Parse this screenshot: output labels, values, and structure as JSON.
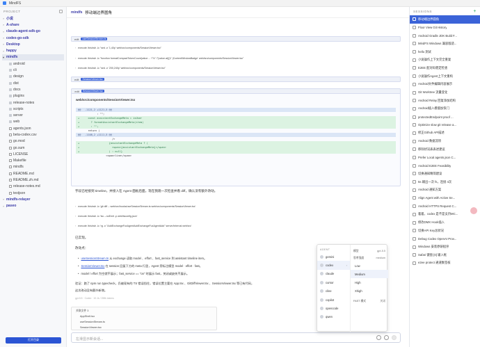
{
  "window": {
    "title": "MindFS"
  },
  "left_sidebar": {
    "header": "PROJECT",
    "tree": [
      {
        "label": "小说",
        "level": 0,
        "type": "folder",
        "expanded": false
      },
      {
        "label": "A-share",
        "level": 0,
        "type": "folder",
        "expanded": false
      },
      {
        "label": "claude-agent-sdk-go",
        "level": 0,
        "type": "folder",
        "expanded": false
      },
      {
        "label": "codex-go-sdk",
        "level": 0,
        "type": "folder",
        "expanded": false
      },
      {
        "label": "Desktop",
        "level": 0,
        "type": "folder",
        "expanded": false
      },
      {
        "label": "happy",
        "level": 0,
        "type": "folder",
        "expanded": false
      },
      {
        "label": "mindfs",
        "level": 0,
        "type": "folder",
        "expanded": true,
        "active": true
      },
      {
        "label": "android",
        "level": 1,
        "type": "folder"
      },
      {
        "label": "cli",
        "level": 1,
        "type": "folder"
      },
      {
        "label": "design",
        "level": 1,
        "type": "folder"
      },
      {
        "label": "dist",
        "level": 1,
        "type": "folder"
      },
      {
        "label": "docs",
        "level": 1,
        "type": "folder"
      },
      {
        "label": "plugins",
        "level": 1,
        "type": "folder"
      },
      {
        "label": "release-notes",
        "level": 1,
        "type": "folder"
      },
      {
        "label": "scripts",
        "level": 1,
        "type": "folder"
      },
      {
        "label": "server",
        "level": 1,
        "type": "folder"
      },
      {
        "label": "web",
        "level": 1,
        "type": "folder"
      },
      {
        "label": "agents.json",
        "level": 1,
        "type": "file"
      },
      {
        "label": "beta-codex.csv",
        "level": 1,
        "type": "file"
      },
      {
        "label": "go.mod",
        "level": 1,
        "type": "file"
      },
      {
        "label": "go.sum",
        "level": 1,
        "type": "file"
      },
      {
        "label": "LICENSE",
        "level": 1,
        "type": "file"
      },
      {
        "label": "Makefile",
        "level": 1,
        "type": "file"
      },
      {
        "label": "mindfs",
        "level": 1,
        "type": "file"
      },
      {
        "label": "README.md",
        "level": 1,
        "type": "file"
      },
      {
        "label": "README.zh.md",
        "level": 1,
        "type": "file"
      },
      {
        "label": "release-notes.md",
        "level": 1,
        "type": "file"
      },
      {
        "label": "testjson",
        "level": 1,
        "type": "file"
      },
      {
        "label": "mindfs-relayer",
        "level": 0,
        "type": "folder",
        "expanded": false
      },
      {
        "label": "paseo",
        "level": 0,
        "type": "folder",
        "expanded": false
      }
    ],
    "open_button": "打开目录"
  },
  "main": {
    "project_tag": "mindfs",
    "session_title": "移动端边界圆角",
    "tool_rows": [
      {
        "name": "edit",
        "file": "useSessionStream.ts"
      },
      {
        "name": "edit",
        "file": "SessionViewer.tsx"
      },
      {
        "name": "edit",
        "file": "SessionViewer.tsx"
      }
    ],
    "commands": [
      "execute /bin/zsh -lc \"sed -n '1,40p' web/src/components/SessionViewer.tsx\"",
      "execute /bin/zsh -lc \"function formatCompactTokenCount(value ... \\\"\\\\\\\" \\\"(value.at())\\\" |ContextWindowBadge' web/src/components/SessionViewer.tsx\"",
      "execute /bin/zsh -lc \"sed -n '200,240p' web/src/components/SessionViewer.tsx\"",
      "execute /bin/zsh -lc 'git diff -- web/src/hooks/useSessionStream.ts web/src/components/SessionViewer.tsx'",
      "execute /bin/zsh -lc 'tsc --noEmit -p web/tsconfig.json'",
      "execute /bin/zsh -lc 'rg -n \"AddExchangeFuxAgentAddExchangeFuxAgentAdd\" server/internal web/src'"
    ],
    "diff": {
      "path": "web/src/components/SessionViewer.tsx",
      "lines": [
        {
          "type": "hunk",
          "sign": "@@",
          "text": "-1121,2 +1121,5 @@"
        },
        {
          "type": "ctx",
          "sign": "",
          "text": "        : \"\";"
        },
        {
          "type": "add",
          "sign": "+",
          "text": "  const assistantExchangeMeta = isUser"
        },
        {
          "type": "add",
          "sign": "+",
          "text": "    ? formatAssistantExchangeMeta(item)"
        },
        {
          "type": "add",
          "sign": "+",
          "text": "    : \"\";"
        },
        {
          "type": "ctx",
          "sign": "",
          "text": "  return ("
        },
        {
          "type": "hunk",
          "sign": "@@",
          "text": "-1108,2 +1111,5 @@"
        },
        {
          "type": "ctx",
          "sign": "",
          "text": "                  />"
        },
        {
          "type": "add",
          "sign": "+",
          "text": "                {assistantExchangeMeta ? ("
        },
        {
          "type": "add",
          "sign": "+",
          "text": "                  <span>{assistantExchangeMeta}</span>"
        },
        {
          "type": "add",
          "sign": "+",
          "text": "                ) : null}"
        },
        {
          "type": "ctx",
          "sign": "",
          "text": "              <span>line</span>"
        }
      ]
    },
    "para1": "字段已经接到 timeline，并接入在 Agent 面板后面。现在我跑一次检查并看 diff，确认没有额外改动。",
    "done": "已实现。",
    "summary_title": "改动点：",
    "bullets": [
      {
        "link": "useSessionStream.ts",
        "text": " 从 exchange 读取 model 、effort 、fast_service 到 assistant timeline item。"
      },
      {
        "link": "SessionViewer.tsx",
        "text": " 在 session 回复下方的 meta 行里，Agent 旁标注模型 model · effort · fast。"
      },
      {
        "link": "",
        "text": "model / effort 为空就不展示；fast_service == \"on\" 时展示 fast，关闭或缺失不展示。"
      }
    ],
    "verify_line": "验证：跑了 npm run typecheck，仍被现有的 TS 错误挡住，错误位置主要在 App.tsx 、GitDiffViewer.tsx 、SessionViewer.tsx 等已有代码，",
    "verify_line2": "这次改动没有额外新增。",
    "meta_small": "gpt-5.5 · Codex · 10.1k / 258k  tokens",
    "files": {
      "title": "关联文件 3",
      "items": [
        "AppShell.tsx",
        "useSessionStream.ts",
        "SessionViewer.tsx"
      ]
    },
    "composer_placeholder": "左滑显示新会话..."
  },
  "agent_menu": {
    "header": "AGENT",
    "agents": [
      "gemini",
      "codex",
      "claude",
      "cursor",
      "cline",
      "copilot",
      "opencode",
      "qwen"
    ],
    "selected_agent": "codex",
    "model_label": "模型",
    "model_value": "gpt-5.5",
    "effort_label": "思考强度",
    "effort_value": "medium",
    "levels": [
      "Low",
      "Medium",
      "High",
      "Xhigh"
    ],
    "selected_level": "Medium",
    "fast_label": "FAST 模式",
    "fast_value": "关闭"
  },
  "right_sidebar": {
    "header": "SESSIONS",
    "sessions": [
      {
        "label": "移动端边界圆角",
        "active": true
      },
      {
        "label": "Floor View Git History"
      },
      {
        "label": "Android Gradle JDK Build F..."
      },
      {
        "label": "MindFS Windows 兼容版适..."
      },
      {
        "label": "hello 测试"
      },
      {
        "label": "小说操作上下文完全重复"
      },
      {
        "label": "E2EE 配对码稳定检查"
      },
      {
        "label": "小说操作Agent上下文重构"
      },
      {
        "label": "Android文件编辑内容展示"
      },
      {
        "label": "Git Worktree 流量变化"
      },
      {
        "label": "Android Relay 回复添加结构"
      },
      {
        "label": "Android插入模版加快门"
      },
      {
        "label": "protectedEndpoint proof ..."
      },
      {
        "label": "Optimize slow git release a..."
      },
      {
        "label": "修正Github API描述"
      },
      {
        "label": "Android 数据流项"
      },
      {
        "label": "移除状况表表述建议"
      },
      {
        "label": "Prefer Local agents.json C..."
      },
      {
        "label": "Android E2EE Feasibility"
      },
      {
        "label": "切换通知精简建议"
      },
      {
        "label": "5s 输出一次 fs，连接 4次"
      },
      {
        "label": "Android 通知方案"
      },
      {
        "label": "Align Agent with Active Se..."
      },
      {
        "label": "Android HTTPS Request C..."
      },
      {
        "label": "着着，codex 是不是支持MC..."
      },
      {
        "label": "修改DMX Hook插入"
      },
      {
        "label": "切换API Key总状况"
      },
      {
        "label": "Debug Codex OpenAI Prov..."
      },
      {
        "label": "Windows 安装原研程序"
      },
      {
        "label": "Safari 键盘 [0] 输入框"
      },
      {
        "label": "e2ee protect 通道数签核"
      }
    ]
  }
}
